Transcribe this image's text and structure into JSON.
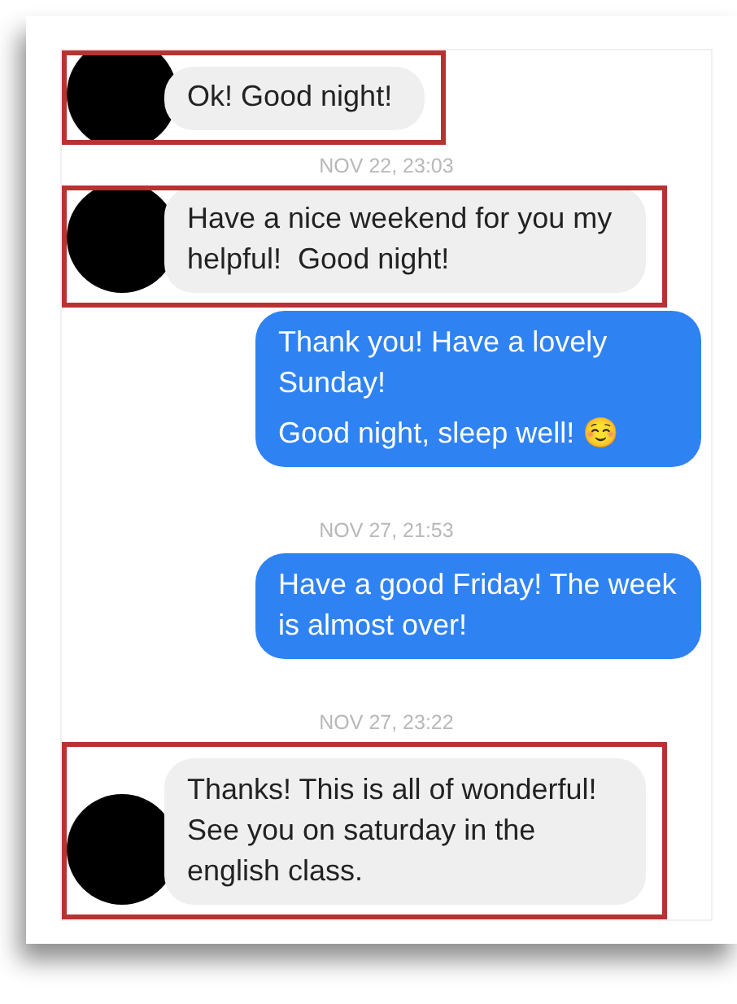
{
  "conversation": [
    {
      "kind": "received",
      "highlighted": true,
      "paragraphs": [
        "Ok! Good night!"
      ]
    },
    {
      "kind": "timestamp",
      "text": "NOV 22, 23:03"
    },
    {
      "kind": "received",
      "highlighted": true,
      "paragraphs": [
        "Have a nice weekend for you my helpful!  Good night!"
      ]
    },
    {
      "kind": "sent",
      "highlighted": false,
      "paragraphs": [
        "Thank you! Have a lovely Sunday!",
        "Good night, sleep well! ☺️"
      ]
    },
    {
      "kind": "timestamp",
      "text": "NOV 27, 21:53"
    },
    {
      "kind": "sent",
      "highlighted": false,
      "paragraphs": [
        "Have a good Friday! The week is almost over!"
      ]
    },
    {
      "kind": "timestamp",
      "text": "NOV 27, 23:22"
    },
    {
      "kind": "received",
      "highlighted": true,
      "paragraphs": [
        "Thanks! This is all of wonderful! See you on saturday in the english class."
      ]
    }
  ]
}
